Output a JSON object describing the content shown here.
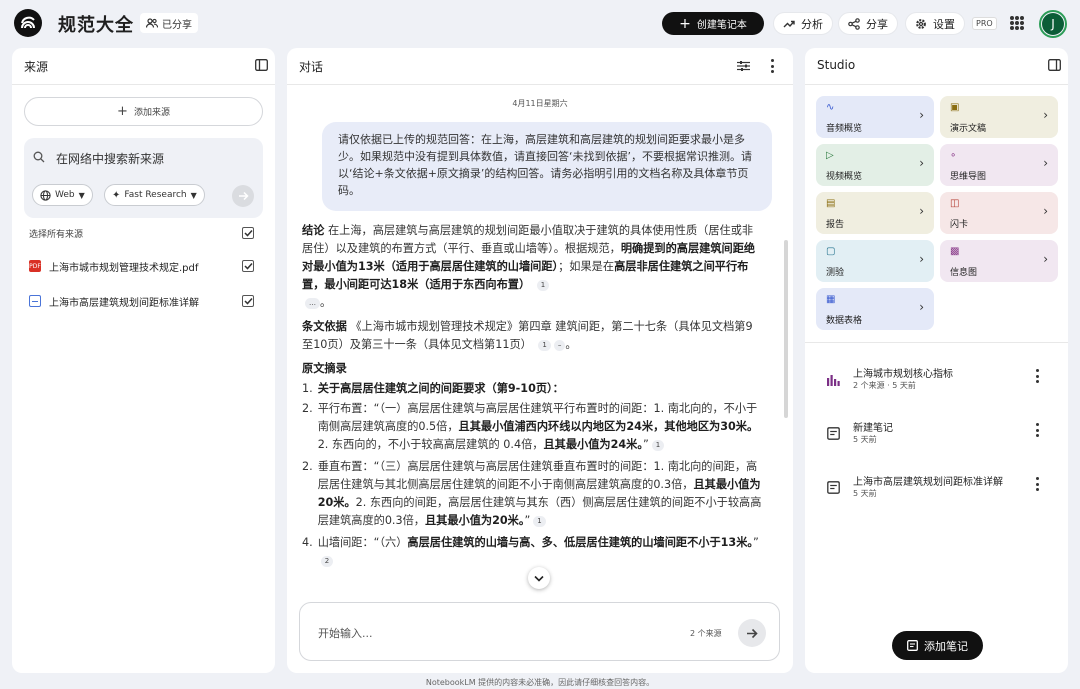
{
  "app": {
    "title": "规范大全",
    "shared_label": "已分享",
    "create_label": "创建笔记本",
    "analyze_label": "分析",
    "share_label": "分享",
    "settings_label": "设置",
    "pro_badge": "PRO",
    "avatar_letter": "J"
  },
  "sources": {
    "title": "来源",
    "add_label": "添加来源",
    "search_placeholder": "在网络中搜索新来源",
    "web_chip": "Web",
    "research_chip": "Fast Research",
    "select_all": "选择所有来源",
    "items": [
      {
        "label": "上海市城市规划管理技术规定.pdf",
        "type": "pdf",
        "checked": true
      },
      {
        "label": "上海市高层建筑规划间距标准详解",
        "type": "doc",
        "checked": true
      }
    ]
  },
  "chat": {
    "title": "对话",
    "date": "4月11日星期六",
    "question": "请仅依据已上传的规范回答：在上海，高层建筑和高层建筑的规划间距要求最小是多少。如果规范中没有提到具体数值，请直接回答‘未找到依据’，不要根据常识推测。请以‘结论+条文依据+原文摘录’的结构回答。请务必指明引用的文档名称及具体章节页码。",
    "answer": {
      "p1_label": "结论",
      "p1_text": " 在上海，高层建筑与高层建筑的规划间距最小值取决于建筑的具体使用性质（居住或非居住）以及建筑的布置方式（平行、垂直或山墙等）。根据规范，",
      "p1_bold1": "明确提到的高层建筑间距绝对最小值为13米（适用于高层居住建筑的山墙间距）",
      "p1_text2": "；如果是在",
      "p1_bold2": "高层非居住建筑之间平行布置，最小间距可达18米（适用于东西向布置）",
      "p1_cite": "1",
      "p1_more": "…",
      "p1_end": "。",
      "p2_label": "条文依据",
      "p2_text": " 《上海市城市规划管理技术规定》第四章 建筑间距，第二十七条（具体见文档第9至10页）及第三十一条（具体见文档第11页）",
      "p2_cite": "1",
      "p2_more": "–",
      "p2_end": "。",
      "p3_label": "原文摘录",
      "li1_num": "1.",
      "li1_text": "关于高层居住建筑之间的间距要求（第9-10页）：",
      "li2_num": "2.",
      "li2_a": "平行布置：“（一）高层居住建筑与高层居住建筑平行布置时的间距：1. 南北向的，不小于南侧高层建筑高度的0.5倍，",
      "li2_b": "且其最小值浦西内环线以内地区为24米，其他地区为30米。",
      "li2_c": "2. 东西向的，不小于较高高层建筑的 0.4倍，",
      "li2_d": "且其最小值为24米。",
      "li2_e": "”",
      "li2_cite": "1",
      "li3_num": "2.",
      "li3_a": "垂直布置：“（三）高层居住建筑与高层居住建筑垂直布置时的间距：1. 南北向的间距，高层居住建筑与其北侧高层居住建筑的间距不小于南侧高层建筑高度的0.3倍，",
      "li3_b": "且其最小值为20米。",
      "li3_c": "2. 东西向的间距，高层居住建筑与其东（西）侧高层居住建筑的间距不小于较高高层建筑高度的0.3倍，",
      "li3_d": "且其最小值为20米。",
      "li3_e": "”",
      "li3_cite": "1",
      "li4_num": "4.",
      "li4_a": "山墙间距：“（六）",
      "li4_b": "高层居住建筑的山墙与高、多、低层居住建筑的山墙间距不小于13米。",
      "li4_e": "”",
      "li4_cite": "2"
    },
    "input_placeholder": "开始输入...",
    "source_count": "2 个来源"
  },
  "studio": {
    "title": "Studio",
    "tiles": [
      {
        "label": "音频概览",
        "icon": "waveform-icon",
        "color": "#e4e9f8",
        "icon_color": "#3a5bd0"
      },
      {
        "label": "演示文稿",
        "icon": "slides-icon",
        "color": "#f0eee0",
        "icon_color": "#8a6d10"
      },
      {
        "label": "视频概览",
        "icon": "video-icon",
        "color": "#e3efe6",
        "icon_color": "#2b7a3e"
      },
      {
        "label": "思维导图",
        "icon": "mindmap-icon",
        "color": "#f1e7f1",
        "icon_color": "#8a3b8a"
      },
      {
        "label": "报告",
        "icon": "report-icon",
        "color": "#f0eee0",
        "icon_color": "#8a6d10"
      },
      {
        "label": "闪卡",
        "icon": "flashcard-icon",
        "color": "#f6e7e7",
        "icon_color": "#b3392f"
      },
      {
        "label": "测验",
        "icon": "quiz-icon",
        "color": "#e2eff4",
        "icon_color": "#1f6f8b"
      },
      {
        "label": "信息图",
        "icon": "infographic-icon",
        "color": "#f1e7f1",
        "icon_color": "#8a3b8a"
      },
      {
        "label": "数据表格",
        "icon": "table-icon",
        "color": "#e4e9f8",
        "icon_color": "#3a5bd0"
      }
    ],
    "notes": [
      {
        "title": "上海城市规划核心指标",
        "meta": "2 个来源 · 5 天前",
        "icon": "chart-icon"
      },
      {
        "title": "新建笔记",
        "meta": "5 天前",
        "icon": "note-icon"
      },
      {
        "title": "上海市高层建筑规划间距标准详解",
        "meta": "5 天前",
        "icon": "note-icon"
      }
    ],
    "add_note_label": "添加笔记"
  },
  "footer": "NotebookLM 提供的内容未必准确，因此请仔细核查回答内容。"
}
